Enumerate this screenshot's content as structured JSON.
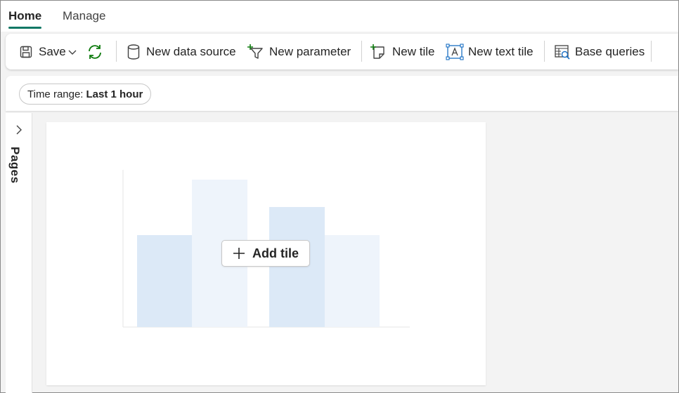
{
  "tabs": [
    {
      "label": "Home",
      "active": true
    },
    {
      "label": "Manage",
      "active": false
    }
  ],
  "toolbar": {
    "save_label": "Save",
    "new_data_source_label": "New data source",
    "new_parameter_label": "New parameter",
    "new_tile_label": "New tile",
    "new_text_tile_label": "New text tile",
    "base_queries_label": "Base queries"
  },
  "filter": {
    "time_range_label": "Time range:",
    "time_range_value": "Last 1 hour"
  },
  "pages_panel": {
    "label": "Pages"
  },
  "canvas": {
    "add_tile_label": "Add tile"
  },
  "colors": {
    "accent": "#117865",
    "refresh_green": "#0f7b0f",
    "bar_light": "#eef4fb",
    "bar_medium": "#dce9f7"
  }
}
